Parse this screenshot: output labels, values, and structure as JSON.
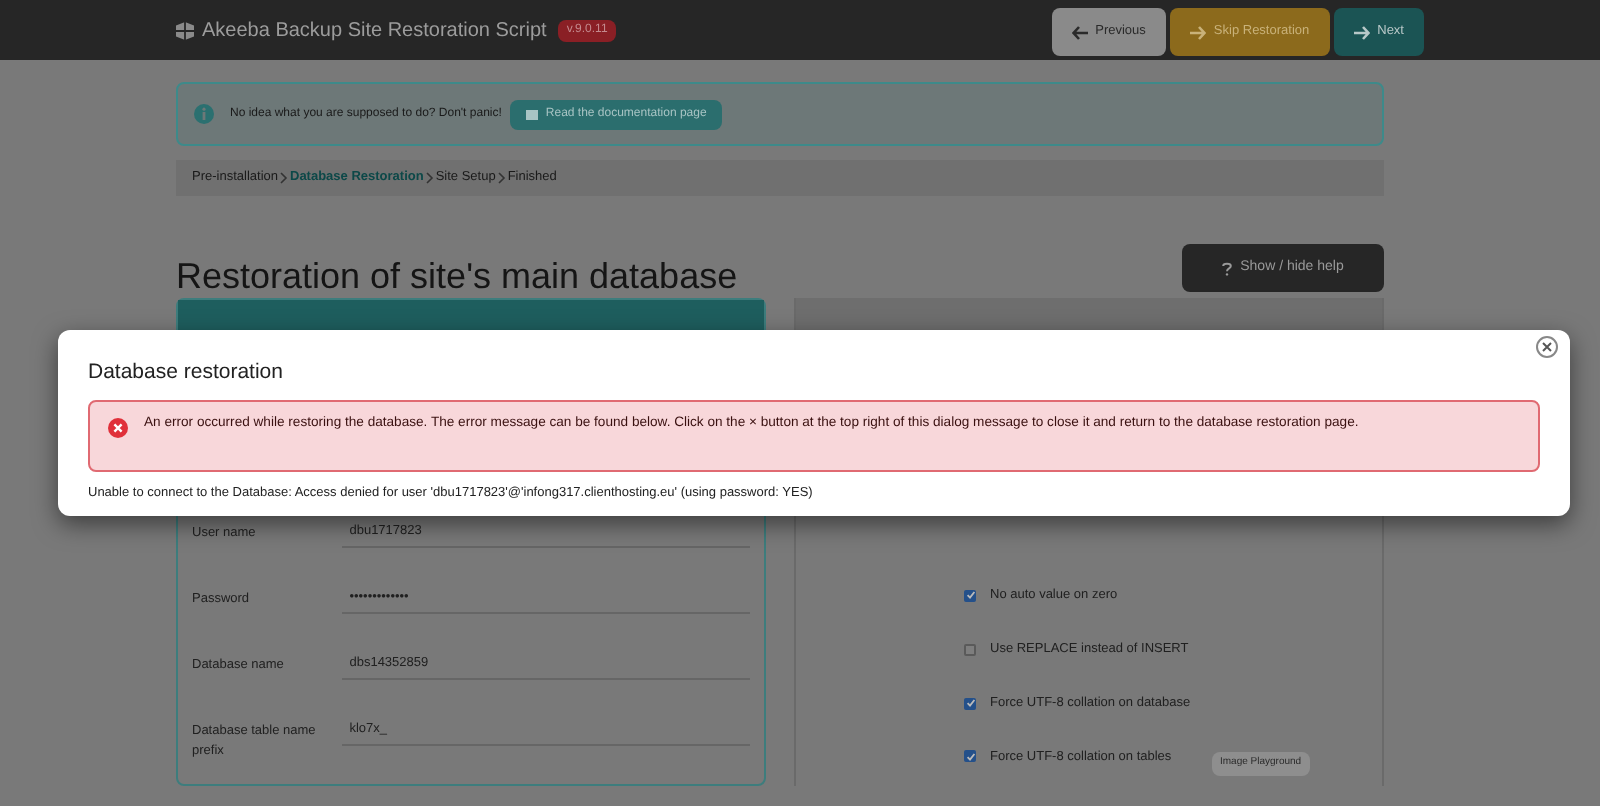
{
  "header": {
    "title": "Akeeba Backup Site Restoration Script",
    "version": "v.9.0.11",
    "buttons": [
      {
        "kind": "previous",
        "label": "Previous"
      },
      {
        "kind": "skip",
        "label": "Skip Restoration"
      },
      {
        "kind": "next",
        "label": "Next"
      }
    ]
  },
  "info": {
    "text": "No idea what you are supposed to do? Don't panic!",
    "button": "Read the documentation page"
  },
  "breadcrumb": [
    {
      "label": "Pre-installation",
      "selected": false
    },
    {
      "label": "Database Restoration",
      "selected": true
    },
    {
      "label": "Site Setup",
      "selected": false
    },
    {
      "label": "Finished",
      "selected": false
    }
  ],
  "page_title": "Restoration of site's main database",
  "help_button": "Show / hide help",
  "connection": {
    "fields": [
      {
        "label": "User name",
        "value": "dbu1717823"
      },
      {
        "label": "Password",
        "value": "•••••••••••••"
      },
      {
        "label": "Database name",
        "value": "dbs14352859"
      },
      {
        "label": "Database table name prefix",
        "value": "klo7x_"
      }
    ]
  },
  "advanced": {
    "options": [
      {
        "label": "No auto value on zero",
        "checked": true
      },
      {
        "label": "Use REPLACE instead of INSERT",
        "checked": false
      },
      {
        "label": "Force UTF-8 collation on database",
        "checked": true
      },
      {
        "label": "Force UTF-8 collation on tables",
        "checked": true
      }
    ]
  },
  "tooltip": "Image Playground",
  "dialog": {
    "title": "Database restoration",
    "alert": "An error occurred while restoring the database. The error message can be found below. Click on the × button at the top right of this dialog message to close it and return to the database restoration page.",
    "message": "Unable to connect to the Database: Access denied for user 'dbu1717823'@'infong317.clienthosting.eu' (using password: YES)"
  }
}
